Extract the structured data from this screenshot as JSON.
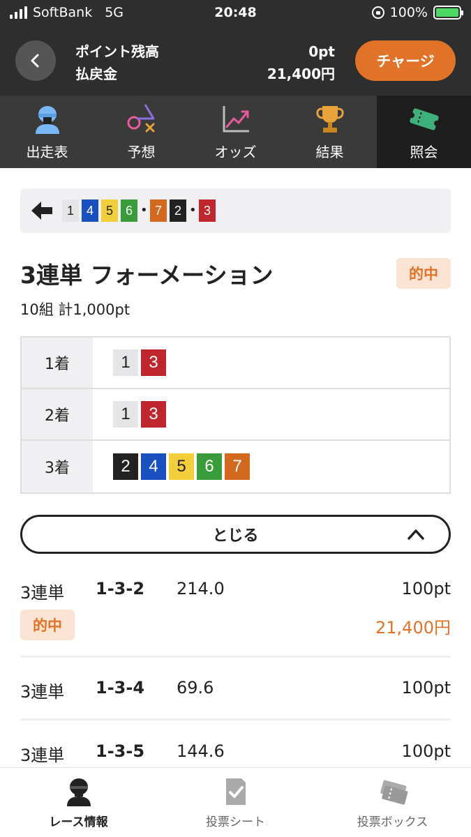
{
  "status_bar": {
    "carrier": "SoftBank",
    "network": "5G",
    "time": "20:48",
    "battery": "100%"
  },
  "header": {
    "points_label": "ポイント残高",
    "refund_label": "払戻金",
    "points_value": "0pt",
    "refund_value": "21,400円",
    "charge_label": "チャージ"
  },
  "tabs": [
    {
      "label": "出走表",
      "icon": "jockey-icon"
    },
    {
      "label": "予想",
      "icon": "symbols-icon"
    },
    {
      "label": "オッズ",
      "icon": "chart-up-icon"
    },
    {
      "label": "結果",
      "icon": "trophy-icon"
    },
    {
      "label": "照会",
      "icon": "ticket-icon",
      "active": true
    }
  ],
  "selection": {
    "chips": [
      "1",
      "4",
      "5",
      "6",
      "7",
      "2",
      "3"
    ]
  },
  "bet": {
    "title": "3連単 フォーメーション",
    "hit_label": "的中",
    "subtitle": "10組 計1,000pt",
    "rows": [
      {
        "place": "1着",
        "nums": [
          "1",
          "3"
        ]
      },
      {
        "place": "2着",
        "nums": [
          "1",
          "3"
        ]
      },
      {
        "place": "3着",
        "nums": [
          "2",
          "4",
          "5",
          "6",
          "7"
        ]
      }
    ]
  },
  "close_label": "とじる",
  "results": [
    {
      "type": "3連単",
      "combo": "1-3-2",
      "odds": "214.0",
      "amount": "100pt",
      "hit_label": "的中",
      "payout": "21,400円"
    },
    {
      "type": "3連単",
      "combo": "1-3-4",
      "odds": "69.6",
      "amount": "100pt"
    },
    {
      "type": "3連単",
      "combo": "1-3-5",
      "odds": "144.6",
      "amount": "100pt"
    }
  ],
  "bottom_nav": [
    {
      "label": "レース情報",
      "icon": "jockey-icon",
      "active": true
    },
    {
      "label": "投票シート",
      "icon": "check-sheet-icon"
    },
    {
      "label": "投票ボックス",
      "icon": "tickets-icon"
    }
  ],
  "colors": {
    "frame1": "#e5e5e7",
    "frame2": "#222222",
    "frame3": "#c0262d",
    "frame4": "#1a4fbf",
    "frame5": "#f2cf3a",
    "frame6": "#3a9b3a",
    "frame7": "#d2691e",
    "accent": "#e07327"
  }
}
